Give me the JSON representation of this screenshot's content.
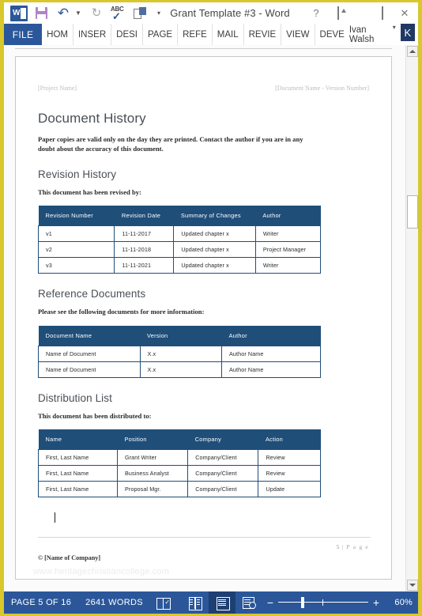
{
  "window": {
    "title": "Grant Template #3 - Word",
    "quick_access": [
      {
        "name": "word-logo-icon",
        "label": "W"
      },
      {
        "name": "save-icon",
        "label": "Save"
      },
      {
        "name": "undo-icon",
        "label": "Undo"
      },
      {
        "name": "redo-icon",
        "label": "Redo"
      },
      {
        "name": "spelling-grammar-icon",
        "label": "ABC"
      },
      {
        "name": "compare-documents-icon",
        "label": "Compare"
      },
      {
        "name": "customize-qat-icon",
        "label": "More"
      }
    ],
    "controls": {
      "help": "?",
      "ribbon_display": "Ribbon Display Options",
      "minimize": "Minimize",
      "maximize": "Maximize",
      "close": "Close"
    }
  },
  "ribbon": {
    "file_tab": "FILE",
    "tabs": [
      "HOM",
      "INSER",
      "DESI",
      "PAGE",
      "REFE",
      "MAIL",
      "REVIE",
      "VIEW",
      "DEVE"
    ],
    "account": {
      "user_name": "Ivan Walsh",
      "avatar_initial": "K"
    }
  },
  "document": {
    "header_left": "[Project Name]",
    "header_right": "[Document Name - Version Number]",
    "title": "Document History",
    "intro_paragraph": "Paper copies are valid only on the day they are printed. Contact the author if you are in any doubt about the accuracy of this document.",
    "sections": [
      {
        "heading": "Revision History",
        "lead_in": "This document has been revised by:",
        "columns": [
          "Revision Number",
          "Revision Date",
          "Summary of Changes",
          "Author"
        ],
        "rows": [
          [
            "v1",
            "11-11-2017",
            "Updated chapter x",
            "Writer"
          ],
          [
            "v2",
            "11-11-2018",
            "Updated chapter x",
            "Project Manager"
          ],
          [
            "v3",
            "11-11-2021",
            "Updated chapter x",
            "Writer"
          ]
        ]
      },
      {
        "heading": "Reference Documents",
        "lead_in": "Please see the following documents for more information:",
        "columns": [
          "Document Name",
          "Version",
          "Author"
        ],
        "rows": [
          [
            "Name of Document",
            "X.x",
            "Author Name"
          ],
          [
            "Name of Document",
            "X.x",
            "Author Name"
          ]
        ]
      },
      {
        "heading": "Distribution List",
        "lead_in": "This document has been distributed to:",
        "columns": [
          "Name",
          "Position",
          "Company",
          "Action"
        ],
        "rows": [
          [
            "First, Last Name",
            "Grant Writer",
            "Company/Client",
            "Review"
          ],
          [
            "First, Last Name",
            "Business Analyst",
            "Company/Client",
            "Review"
          ],
          [
            "First, Last Name",
            "Proposal Mgr.",
            "Company/Client",
            "Update"
          ]
        ]
      }
    ],
    "footer": {
      "page_number": "5",
      "page_separator": "|",
      "page_label": "P a g e",
      "copyright": "© [Name of Company]"
    },
    "watermark": "www.heritagechristiancollege.com"
  },
  "status_bar": {
    "page_status": "PAGE 5 OF 16",
    "word_count": "2641 WORDS",
    "proofing_icon": "proofing-errors-icon",
    "view_buttons": [
      {
        "name": "read-mode-icon",
        "label": "Read Mode"
      },
      {
        "name": "print-layout-icon",
        "label": "Print Layout",
        "active": true
      },
      {
        "name": "web-layout-icon",
        "label": "Web Layout"
      }
    ],
    "zoom": {
      "out_label": "−",
      "in_label": "+",
      "level": "60%"
    }
  },
  "colors": {
    "window_border": "#d9c72c",
    "ribbon_blue": "#2b579a",
    "table_header": "#1f4e79",
    "avatar": "#1f3864"
  }
}
